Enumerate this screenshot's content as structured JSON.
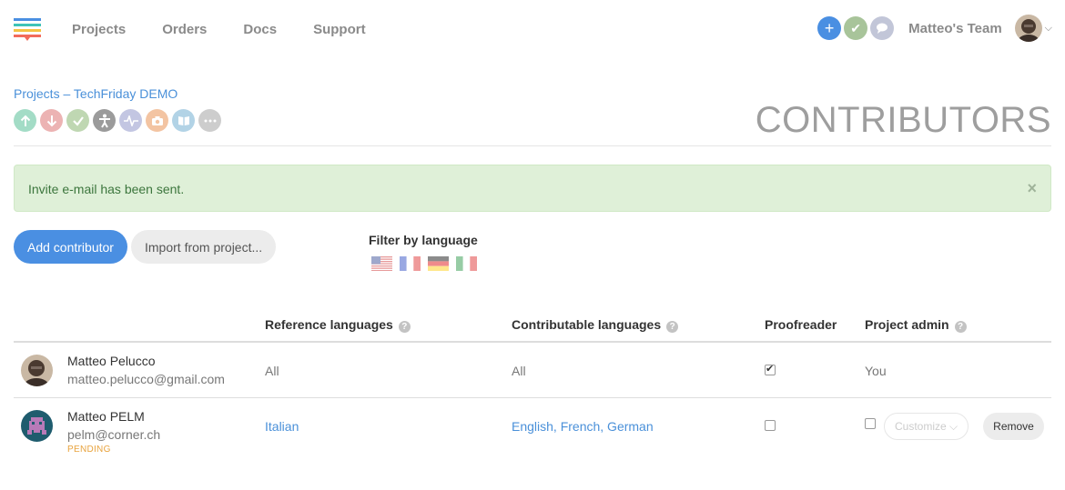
{
  "nav": {
    "links": [
      "Projects",
      "Orders",
      "Docs",
      "Support"
    ],
    "team": "Matteo's Team"
  },
  "breadcrumb": {
    "projects": "Projects",
    "separator": "–",
    "project": "TechFriday DEMO"
  },
  "page_title": "CONTRIBUTORS",
  "toolbar_icons": [
    "upload-icon",
    "download-icon",
    "check-icon",
    "accessibility-icon",
    "activity-icon",
    "camera-icon",
    "book-icon",
    "more-icon"
  ],
  "alert": {
    "text": "Invite e-mail has been sent.",
    "close": "×"
  },
  "actions": {
    "add": "Add contributor",
    "import": "Import from project..."
  },
  "filter": {
    "label": "Filter by language",
    "flags": [
      "flag-us-icon",
      "flag-fr-icon",
      "flag-de-icon",
      "flag-it-icon"
    ]
  },
  "table": {
    "headers": {
      "reference": "Reference languages",
      "contributable": "Contributable languages",
      "proofreader": "Proofreader",
      "admin": "Project admin"
    },
    "rows": [
      {
        "name": "Matteo Pelucco",
        "email": "matteo.pelucco@gmail.com",
        "reference": "All",
        "contributable": "All",
        "proofreader": true,
        "admin": "You"
      },
      {
        "name": "Matteo PELM",
        "email": "pelm@corner.ch",
        "status": "PENDING",
        "reference": "Italian",
        "contributable": "English, French, German",
        "proofreader": false,
        "admin": false,
        "customize": "Customize",
        "remove": "Remove"
      }
    ]
  }
}
